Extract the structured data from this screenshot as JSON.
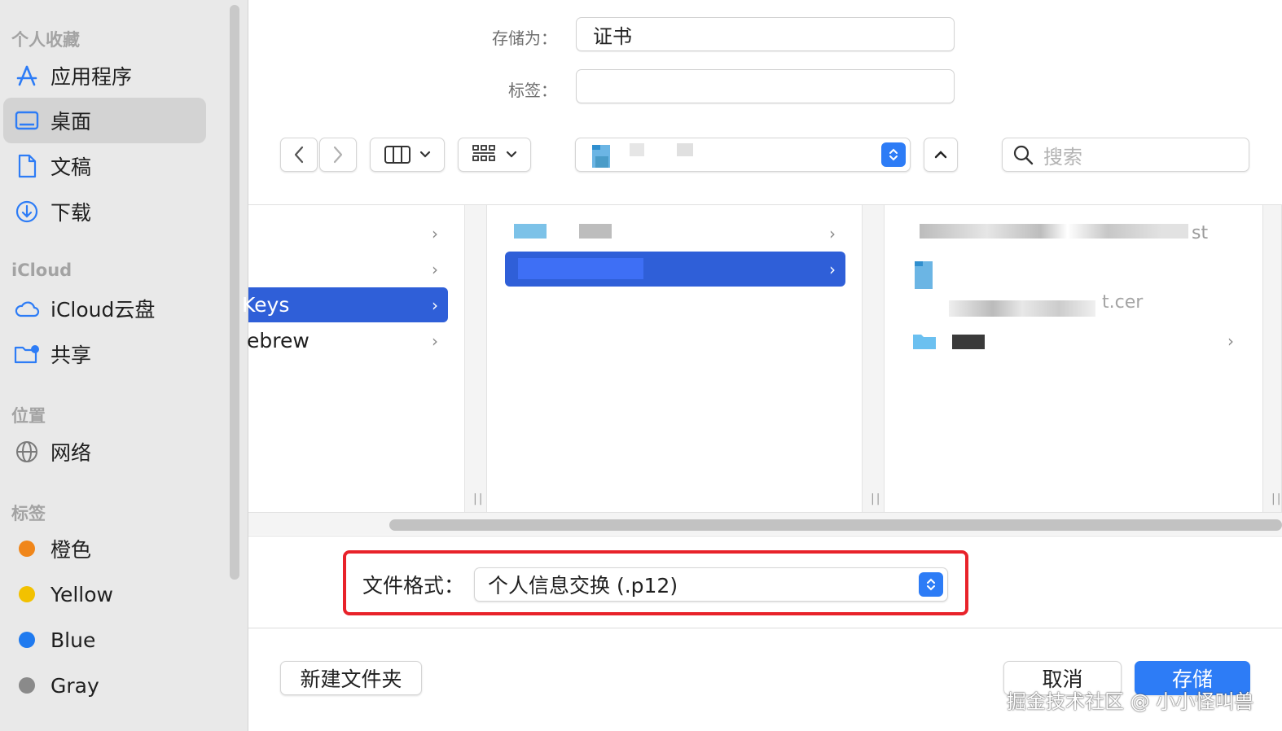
{
  "colors": {
    "accent": "#2d7cf6",
    "selection": "#2f5fd8",
    "highlight_box": "#e8222a"
  },
  "sidebar": {
    "sections": [
      {
        "title": "个人收藏",
        "items": [
          {
            "label": "应用程序",
            "icon": "app-store-icon"
          },
          {
            "label": "桌面",
            "icon": "desktop-icon",
            "selected": true
          },
          {
            "label": "文稿",
            "icon": "document-icon"
          },
          {
            "label": "下载",
            "icon": "download-icon"
          }
        ]
      },
      {
        "title": "iCloud",
        "items": [
          {
            "label": "iCloud云盘",
            "icon": "cloud-icon"
          },
          {
            "label": "共享",
            "icon": "shared-folder-icon"
          }
        ]
      },
      {
        "title": "位置",
        "items": [
          {
            "label": "网络",
            "icon": "globe-icon"
          }
        ]
      },
      {
        "title": "标签",
        "items": [
          {
            "label": "橙色",
            "color": "#f0861a"
          },
          {
            "label": "Yellow",
            "color": "#f2c100"
          },
          {
            "label": "Blue",
            "color": "#1f7aef"
          },
          {
            "label": "Gray",
            "color": "#8a8a8a"
          }
        ]
      }
    ]
  },
  "form": {
    "save_as_label": "存储为：",
    "save_as_value": "证书",
    "tags_label": "标签：",
    "tags_value": ""
  },
  "toolbar": {
    "back_icon": "chevron-left-icon",
    "forward_icon": "chevron-right-icon",
    "view_icon": "column-view-icon",
    "group_icon": "grid-view-icon",
    "expand_icon": "chevron-up-icon",
    "search_placeholder": "搜索"
  },
  "browser": {
    "column1_rows": [
      {
        "label": "",
        "has_children": true
      },
      {
        "label": "",
        "has_children": true
      },
      {
        "label": "Keys",
        "has_children": true,
        "selected": true
      },
      {
        "label": "ebrew",
        "has_children": true
      }
    ],
    "column3_visible_text": [
      "st",
      "t.cer"
    ]
  },
  "format": {
    "label": "文件格式：",
    "value": "个人信息交换 (.p12)"
  },
  "buttons": {
    "new_folder": "新建文件夹",
    "cancel": "取消",
    "save": "存储"
  },
  "watermark": "掘金技术社区 @ 小小怪叫兽"
}
